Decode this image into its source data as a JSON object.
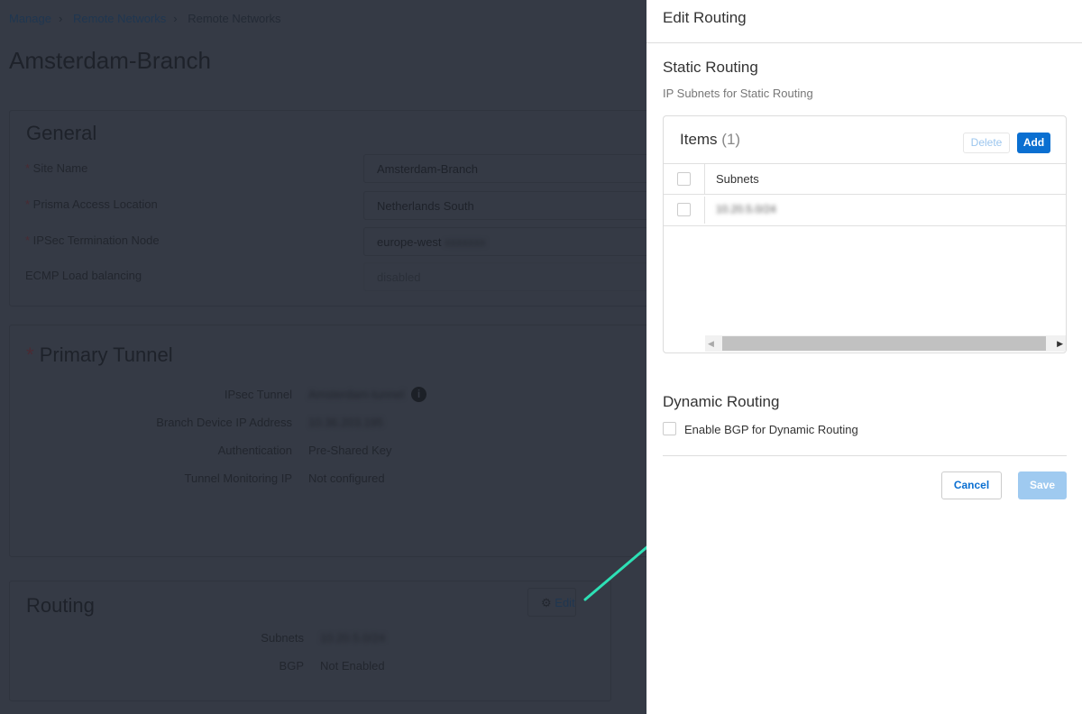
{
  "breadcrumb": {
    "items": [
      "Manage",
      "Remote Networks",
      "Remote Networks"
    ]
  },
  "page_title": "Amsterdam-Branch",
  "general": {
    "title": "General",
    "fields": [
      {
        "label": "Site Name",
        "value": "Amsterdam-Branch",
        "required": true
      },
      {
        "label": "Prisma Access Location",
        "value": "Netherlands South",
        "required": true
      },
      {
        "label": "IPSec Termination Node",
        "value": "europe-west",
        "value_blurred": "xxxxxxx",
        "required": true
      },
      {
        "label": "ECMP Load balancing",
        "value": "disabled",
        "required": false
      }
    ]
  },
  "primary_tunnel": {
    "title": "Primary Tunnel",
    "rows": [
      {
        "label": "IPsec Tunnel",
        "value": "Amsterdam-tunnel"
      },
      {
        "label": "Branch Device IP Address",
        "value": "10.36.203.195"
      },
      {
        "label": "Authentication",
        "value": "Pre-Shared Key"
      },
      {
        "label": "Tunnel Monitoring IP",
        "value": "Not configured"
      }
    ]
  },
  "routing": {
    "title": "Routing",
    "edit_label": "Edit",
    "rows": [
      {
        "label": "Subnets",
        "value": "10.20.5.0/24"
      },
      {
        "label": "BGP",
        "value": "Not Enabled"
      }
    ]
  },
  "drawer": {
    "title": "Edit Routing",
    "static_title": "Static Routing",
    "static_sub": "IP Subnets for Static Routing",
    "items_label": "Items",
    "items_count": "(1)",
    "delete_label": "Delete",
    "add_label": "Add",
    "column": "Subnets",
    "rows": [
      "10.20.5.0/24"
    ],
    "dynamic_title": "Dynamic Routing",
    "bgp_label": "Enable BGP for Dynamic Routing",
    "cancel_label": "Cancel",
    "save_label": "Save"
  },
  "colors": {
    "accent": "#0a6fd1",
    "arrow": "#2de0b5"
  }
}
